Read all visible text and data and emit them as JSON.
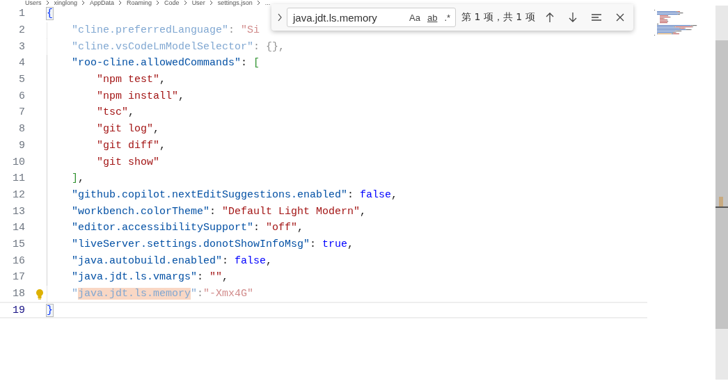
{
  "breadcrumb": [
    "Users",
    "xinglong",
    "AppData",
    "Roaming",
    "Code",
    "User",
    "settings.json",
    "..."
  ],
  "find_widget": {
    "value": "java.jdt.ls.memory",
    "options": [
      {
        "label": "Aa",
        "kind": "case",
        "on": false
      },
      {
        "label": "ab",
        "kind": "word",
        "on": false
      },
      {
        "label": ".*",
        "kind": "regex",
        "on": false
      }
    ],
    "match_count": "第 1 项，共 1 项"
  },
  "lines": [
    {
      "number": "1",
      "tokens": [
        {
          "kind": "brace",
          "text": "{"
        }
      ],
      "faded": false,
      "current": false,
      "bulb": false,
      "children": [
        {
          "number": "2",
          "tokens": [
            {
              "kind": "key",
              "text": "\"cline.preferredLanguage\""
            },
            {
              "kind": "punct",
              "text": ": "
            },
            {
              "kind": "string",
              "text": "\"Si"
            }
          ],
          "faded": true,
          "current": false,
          "bulb": false
        },
        {
          "number": "3",
          "tokens": [
            {
              "kind": "key",
              "text": "\"cline.vsCodeLmModelSelector\""
            },
            {
              "kind": "punct",
              "text": ": {},"
            }
          ],
          "faded": true,
          "current": false,
          "bulb": false
        },
        {
          "number": "4",
          "tokens": [
            {
              "kind": "key",
              "text": "\"roo-cline.allowedCommands\""
            },
            {
              "kind": "punct",
              "text": ": "
            },
            {
              "kind": "bracket",
              "text": "["
            }
          ],
          "faded": false,
          "current": false,
          "bulb": false,
          "children": [
            {
              "number": "5",
              "tokens": [
                {
                  "kind": "string",
                  "text": "\"npm test\""
                },
                {
                  "kind": "punct",
                  "text": ","
                }
              ],
              "faded": false,
              "current": false,
              "bulb": false
            },
            {
              "number": "6",
              "tokens": [
                {
                  "kind": "string",
                  "text": "\"npm install\""
                },
                {
                  "kind": "punct",
                  "text": ","
                }
              ],
              "faded": false,
              "current": false,
              "bulb": false
            },
            {
              "number": "7",
              "tokens": [
                {
                  "kind": "string",
                  "text": "\"tsc\""
                },
                {
                  "kind": "punct",
                  "text": ","
                }
              ],
              "faded": false,
              "current": false,
              "bulb": false
            },
            {
              "number": "8",
              "tokens": [
                {
                  "kind": "string",
                  "text": "\"git log\""
                },
                {
                  "kind": "punct",
                  "text": ","
                }
              ],
              "faded": false,
              "current": false,
              "bulb": false
            },
            {
              "number": "9",
              "tokens": [
                {
                  "kind": "string",
                  "text": "\"git diff\""
                },
                {
                  "kind": "punct",
                  "text": ","
                }
              ],
              "faded": false,
              "current": false,
              "bulb": false
            },
            {
              "number": "10",
              "tokens": [
                {
                  "kind": "string",
                  "text": "\"git show\""
                }
              ],
              "faded": false,
              "current": false,
              "bulb": false
            }
          ]
        },
        {
          "number": "11",
          "tokens": [
            {
              "kind": "bracket",
              "text": "]"
            },
            {
              "kind": "punct",
              "text": ","
            }
          ],
          "faded": false,
          "current": false,
          "bulb": false
        },
        {
          "number": "12",
          "tokens": [
            {
              "kind": "key",
              "text": "\"github.copilot.nextEditSuggestions.enabled\""
            },
            {
              "kind": "punct",
              "text": ": "
            },
            {
              "kind": "keyword",
              "text": "false"
            },
            {
              "kind": "punct",
              "text": ","
            }
          ],
          "faded": false,
          "current": false,
          "bulb": false
        },
        {
          "number": "13",
          "tokens": [
            {
              "kind": "key",
              "text": "\"workbench.colorTheme\""
            },
            {
              "kind": "punct",
              "text": ": "
            },
            {
              "kind": "string",
              "text": "\"Default Light Modern\""
            },
            {
              "kind": "punct",
              "text": ","
            }
          ],
          "faded": false,
          "current": false,
          "bulb": false
        },
        {
          "number": "14",
          "tokens": [
            {
              "kind": "key",
              "text": "\"editor.accessibilitySupport\""
            },
            {
              "kind": "punct",
              "text": ": "
            },
            {
              "kind": "string",
              "text": "\"off\""
            },
            {
              "kind": "punct",
              "text": ","
            }
          ],
          "faded": false,
          "current": false,
          "bulb": false
        },
        {
          "number": "15",
          "tokens": [
            {
              "kind": "key",
              "text": "\"liveServer.settings.donotShowInfoMsg\""
            },
            {
              "kind": "punct",
              "text": ": "
            },
            {
              "kind": "keyword",
              "text": "true"
            },
            {
              "kind": "punct",
              "text": ","
            }
          ],
          "faded": false,
          "current": false,
          "bulb": false
        },
        {
          "number": "16",
          "tokens": [
            {
              "kind": "key",
              "text": "\"java.autobuild.enabled\""
            },
            {
              "kind": "punct",
              "text": ": "
            },
            {
              "kind": "keyword",
              "text": "false"
            },
            {
              "kind": "punct",
              "text": ","
            }
          ],
          "faded": false,
          "current": false,
          "bulb": false
        },
        {
          "number": "17",
          "tokens": [
            {
              "kind": "key",
              "text": "\"java.jdt.ls.vmargs\""
            },
            {
              "kind": "punct",
              "text": ": "
            },
            {
              "kind": "string",
              "text": "\"\""
            },
            {
              "kind": "punct",
              "text": ","
            }
          ],
          "faded": false,
          "current": false,
          "bulb": false
        },
        {
          "number": "18",
          "tokens": [
            {
              "kind": "key",
              "text": "\""
            },
            {
              "kind": "key",
              "text": "java.jdt.ls.memory",
              "match": true
            },
            {
              "kind": "key",
              "text": "\""
            },
            {
              "kind": "punct",
              "text": ":"
            },
            {
              "kind": "string",
              "text": "\"-Xmx4G\""
            }
          ],
          "faded": true,
          "current": false,
          "bulb": true
        }
      ]
    },
    {
      "number": "19",
      "tokens": [
        {
          "kind": "brace",
          "text": "}"
        }
      ],
      "faded": false,
      "current": true,
      "bulb": false
    }
  ]
}
